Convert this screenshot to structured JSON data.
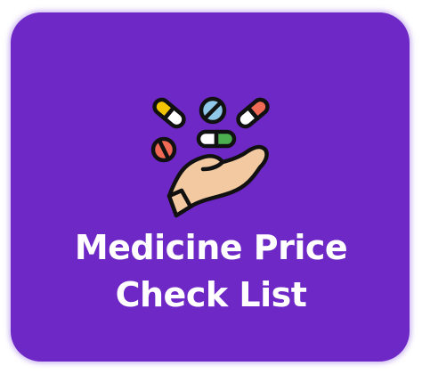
{
  "app": {
    "title_line1": "Medicine Price",
    "title_line2": "Check List",
    "icon": "pills-in-hand-icon"
  },
  "colors": {
    "tile_background": "#6e28c6",
    "title_text": "#ffffff",
    "glow": "#a078e6"
  }
}
